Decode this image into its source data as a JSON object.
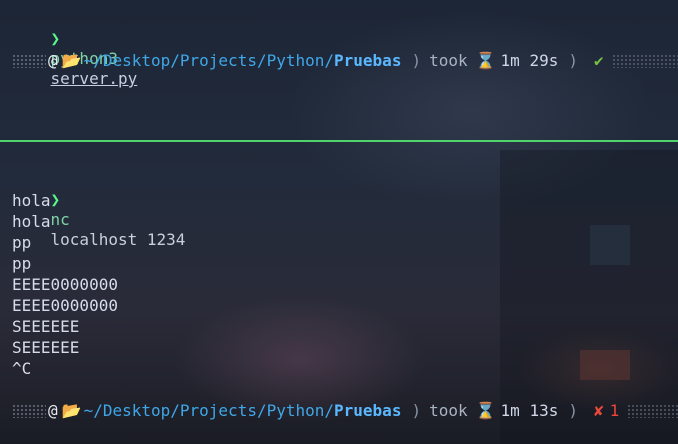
{
  "pane_top": {
    "prompt_symbol": "❯",
    "command": "python3",
    "argument": "server.py",
    "status": {
      "swirl_icon": "@",
      "folder_icon": "📂",
      "path_prefix": "~/Desktop/Projects/Python/",
      "path_leaf": "Pruebas",
      "separator": ")",
      "took_label": "took",
      "hourglass_icon": "⌛",
      "duration": "1m 29s",
      "separator2": ")",
      "result_icon": "✔"
    }
  },
  "pane_bottom": {
    "prompt_symbol": "❯",
    "command": "nc",
    "argument": "localhost 1234",
    "output": [
      "hola",
      "hola",
      "pp",
      "pp",
      "EEEE0000000",
      "EEEE0000000",
      "SEEEEEE",
      "SEEEEEE",
      "^C"
    ],
    "status": {
      "swirl_icon": "@",
      "folder_icon": "📂",
      "path_prefix": "~/Desktop/Projects/Python/",
      "path_leaf": "Pruebas",
      "separator": ")",
      "took_label": "took",
      "hourglass_icon": "⌛",
      "duration": "1m 13s",
      "separator2": ")",
      "result_icon": "✘",
      "exit_code": "1"
    }
  },
  "colors": {
    "divider": "#4fd36a",
    "prompt": "#5af78e",
    "path": "#3fa7e8",
    "success": "#77c043",
    "error": "#e8473a"
  }
}
